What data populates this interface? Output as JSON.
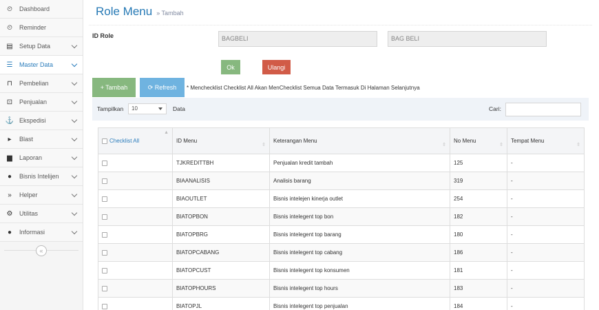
{
  "sidebar": {
    "items": [
      {
        "label": "Dashboard",
        "icon": "tachometer-icon",
        "glyph": "⏲",
        "chevron": false,
        "active": false
      },
      {
        "label": "Reminder",
        "icon": "reminder-icon",
        "glyph": "⏲",
        "chevron": false,
        "active": false
      },
      {
        "label": "Setup Data",
        "icon": "documents-icon",
        "glyph": "▤",
        "chevron": true,
        "active": false
      },
      {
        "label": "Master Data",
        "icon": "database-icon",
        "glyph": "☰",
        "chevron": true,
        "active": true
      },
      {
        "label": "Pembelian",
        "icon": "shopping-basket-icon",
        "glyph": "⊓",
        "chevron": true,
        "active": false
      },
      {
        "label": "Penjualan",
        "icon": "money-icon",
        "glyph": "⊡",
        "chevron": true,
        "active": false
      },
      {
        "label": "Ekspedisi",
        "icon": "anchor-icon",
        "glyph": "⚓",
        "chevron": true,
        "active": false
      },
      {
        "label": "Blast",
        "icon": "caret-right-icon",
        "glyph": "▸",
        "chevron": true,
        "active": false
      },
      {
        "label": "Laporan",
        "icon": "file-icon",
        "glyph": "▆",
        "chevron": true,
        "active": false
      },
      {
        "label": "Bisnis Intelijen",
        "icon": "user-icon",
        "glyph": "●",
        "chevron": true,
        "active": false
      },
      {
        "label": "Helper",
        "icon": "double-angle-right-icon",
        "glyph": "»",
        "chevron": true,
        "active": false
      },
      {
        "label": "Utilitas",
        "icon": "cogs-icon",
        "glyph": "⚙",
        "chevron": true,
        "active": false
      },
      {
        "label": "Informasi",
        "icon": "info-circle-icon",
        "glyph": "●",
        "chevron": true,
        "active": false
      }
    ],
    "collapse_glyph": "«"
  },
  "header": {
    "title": "Role Menu",
    "subtitle": "» Tambah"
  },
  "form": {
    "id_role_label": "ID Role",
    "id_role_value": "BAGBELI",
    "role_name_value": "BAG BELI",
    "ok_label": "Ok",
    "reset_label": "Ulangi"
  },
  "actions": {
    "tambah_label": "+ Tambah",
    "refresh_label": "⟳ Refresh",
    "note": "* Menchecklist Checklist All Akan MenChecklist Semua Data Termasuk Di Halaman Selanjutnya"
  },
  "toolbar": {
    "show_label": "Tampilkan",
    "page_size": "10",
    "data_label": "Data",
    "search_label": "Cari:"
  },
  "colors": {
    "accent": "#2679b5",
    "ok": "#87b87f",
    "reset": "#d15b47",
    "tambah": "#87b87f",
    "refresh": "#6fb3e0"
  },
  "table": {
    "headers": {
      "check": "Checklist All",
      "id": "ID Menu",
      "desc": "Keterangan Menu",
      "no": "No Menu",
      "place": "Tempat Menu"
    },
    "rows": [
      {
        "id": "TJKREDITTBH",
        "desc": "Penjualan kredit tambah",
        "no": "125",
        "place": "-"
      },
      {
        "id": "BIAANALISIS",
        "desc": "Analisis barang",
        "no": "319",
        "place": "-"
      },
      {
        "id": "BIAOUTLET",
        "desc": "Bisnis intelejen kinerja outlet",
        "no": "254",
        "place": "-"
      },
      {
        "id": "BIATOPBON",
        "desc": "Bisnis intelegent top bon",
        "no": "182",
        "place": "-"
      },
      {
        "id": "BIATOPBRG",
        "desc": "Bisnis intelegent top barang",
        "no": "180",
        "place": "-"
      },
      {
        "id": "BIATOPCABANG",
        "desc": "Bisnis intelegent top cabang",
        "no": "186",
        "place": "-"
      },
      {
        "id": "BIATOPCUST",
        "desc": "Bisnis intelegent top konsumen",
        "no": "181",
        "place": "-"
      },
      {
        "id": "BIATOPHOURS",
        "desc": "Bisnis intelegent top hours",
        "no": "183",
        "place": "-"
      },
      {
        "id": "BIATOPJL",
        "desc": "Bisnis intelegent top penjualan",
        "no": "184",
        "place": "-"
      }
    ]
  }
}
